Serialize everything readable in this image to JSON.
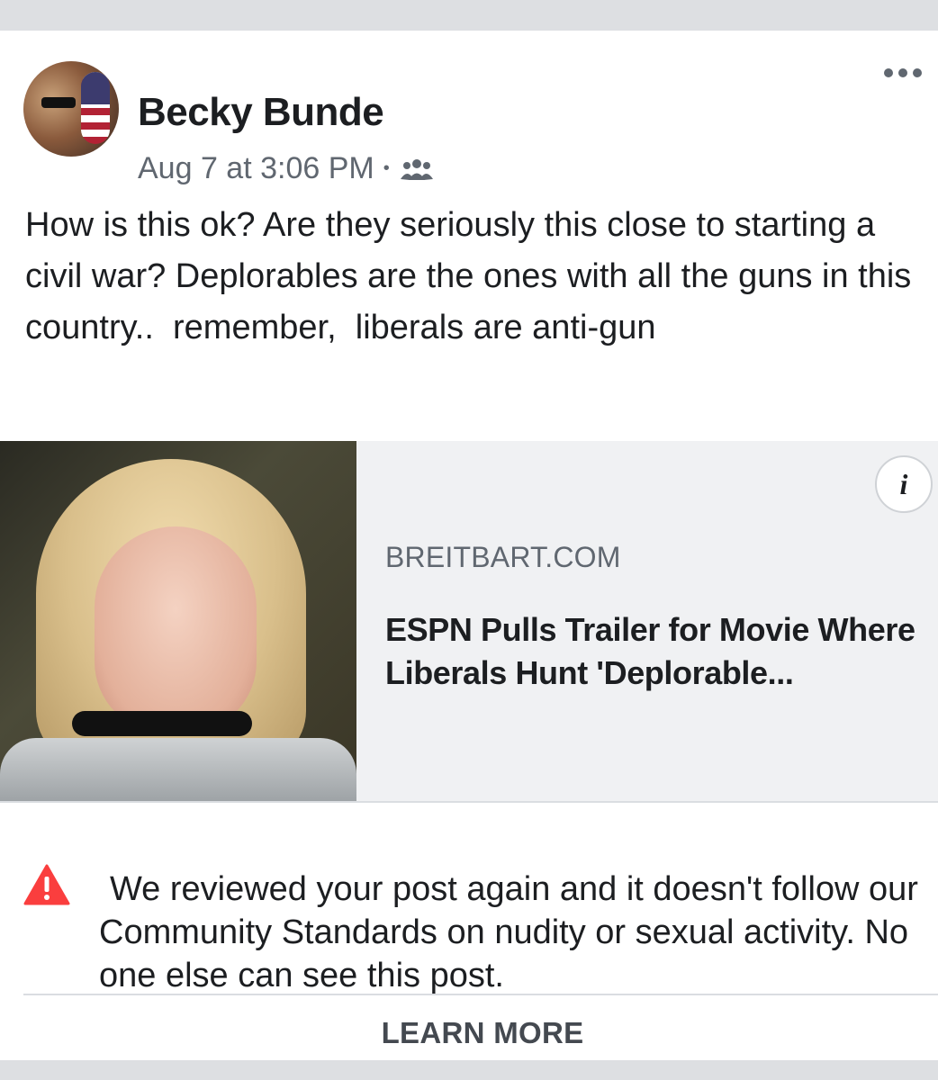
{
  "post": {
    "author": "Becky Bunde",
    "timestamp": "Aug 7 at 3:06 PM",
    "separator": "•",
    "audience_icon": "friends-icon",
    "text": "How is this ok? Are they seriously this close to starting a civil war? Deplorables are the ones with all the guns in this country..  remember,  liberals are anti-gun"
  },
  "link": {
    "domain": "BREITBART.COM",
    "title": "ESPN Pulls Trailer for Movie Where Liberals Hunt 'Deplorable...",
    "info_label": "i"
  },
  "notice": {
    "text": "We reviewed your post again and it doesn't follow our Community Standards on nudity or sexual activity. No one else can see this post.",
    "action": "LEARN MORE"
  },
  "colors": {
    "warning": "#fa3e3e",
    "secondary_text": "#606770",
    "primary_text": "#1c1e21"
  }
}
